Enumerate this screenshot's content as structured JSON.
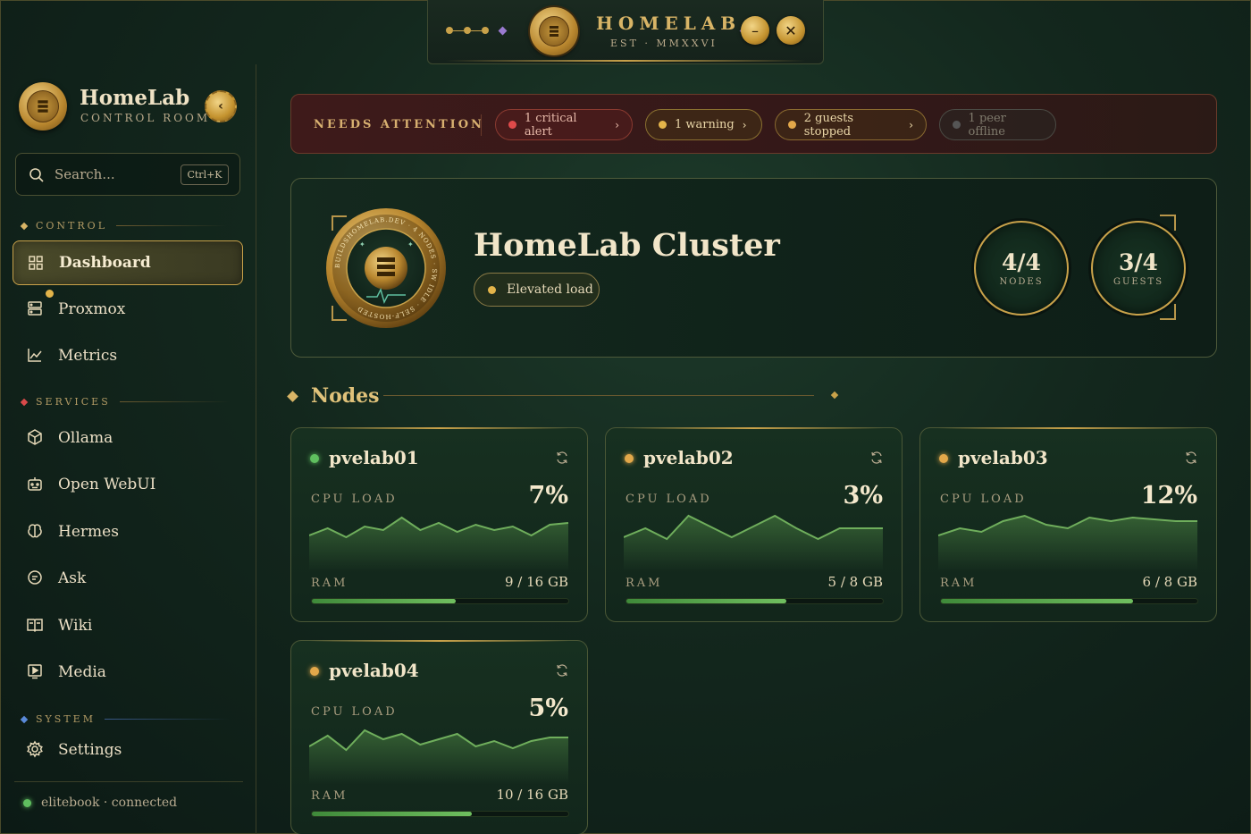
{
  "titlebar": {
    "title": "HOMELAB",
    "subtitle": "EST · MMXXVI",
    "minimize_glyph": "–",
    "close_glyph": "✕"
  },
  "sidebar": {
    "brand_name": "HomeLab",
    "brand_sub": "CONTROL ROOM",
    "collapse_glyph": "‹",
    "search": {
      "placeholder": "Search...",
      "shortcut": "Ctrl+K"
    },
    "sections": [
      {
        "title": "CONTROL",
        "color": "#d8b466"
      },
      {
        "title": "SERVICES",
        "color": "#d94a4a"
      },
      {
        "title": "SYSTEM",
        "color": "#5a8ad9"
      }
    ],
    "items": [
      {
        "label": "Dashboard",
        "icon": "grid-icon",
        "active": true
      },
      {
        "label": "Proxmox",
        "icon": "server-icon"
      },
      {
        "label": "Metrics",
        "icon": "chart-icon"
      },
      {
        "label": "Ollama",
        "icon": "cube-icon"
      },
      {
        "label": "Open WebUI",
        "icon": "robot-icon"
      },
      {
        "label": "Hermes",
        "icon": "brain-icon"
      },
      {
        "label": "Ask",
        "icon": "chat-icon"
      },
      {
        "label": "Wiki",
        "icon": "book-icon"
      },
      {
        "label": "Media",
        "icon": "play-icon"
      },
      {
        "label": "Settings",
        "icon": "gear-icon"
      }
    ],
    "connection": "elitebook · connected"
  },
  "attention": {
    "label": "NEEDS ATTENTION",
    "chips": [
      {
        "label": "1 critical alert",
        "color": "#e04a4a",
        "arrow": "›"
      },
      {
        "label": "1 warning",
        "color": "#e3b44a",
        "arrow": "›"
      },
      {
        "label": "2 guests stopped",
        "color": "#e3a84a",
        "arrow": "›"
      },
      {
        "label": "1 peer offline",
        "color": "#555555",
        "arrow": ""
      }
    ]
  },
  "hero": {
    "title": "HomeLab Cluster",
    "status": "Elevated load",
    "ring_text": "BUILDSHOMELAB.DEV · 4 NODES · SW IDLE · SELF-HOSTED",
    "stats": [
      {
        "value": "4/4",
        "label": "NODES"
      },
      {
        "value": "3/4",
        "label": "GUESTS"
      }
    ]
  },
  "nodes_section": {
    "title": "Nodes"
  },
  "nodes": [
    {
      "name": "pvelab01",
      "status_color": "#5fbf5f",
      "cpu_label": "CPU LOAD",
      "cpu": "7%",
      "ram_label": "RAM",
      "ram": "9 / 16 GB",
      "ram_fraction": 0.5625,
      "spark": [
        0.35,
        0.55,
        0.3,
        0.6,
        0.5,
        0.85,
        0.5,
        0.7,
        0.45,
        0.65,
        0.5,
        0.6,
        0.35,
        0.65,
        0.7
      ]
    },
    {
      "name": "pvelab02",
      "status_color": "#e3a84a",
      "cpu_label": "CPU LOAD",
      "cpu": "3%",
      "ram_label": "RAM",
      "ram": "5 / 8 GB",
      "ram_fraction": 0.625,
      "spark": [
        0.3,
        0.55,
        0.25,
        0.9,
        0.6,
        0.3,
        0.6,
        0.9,
        0.55,
        0.25,
        0.55,
        0.55,
        0.55
      ]
    },
    {
      "name": "pvelab03",
      "status_color": "#e3a84a",
      "cpu_label": "CPU LOAD",
      "cpu": "12%",
      "ram_label": "RAM",
      "ram": "6 / 8 GB",
      "ram_fraction": 0.75,
      "spark": [
        0.35,
        0.55,
        0.45,
        0.75,
        0.9,
        0.65,
        0.55,
        0.85,
        0.75,
        0.85,
        0.8,
        0.75,
        0.75
      ]
    },
    {
      "name": "pvelab04",
      "status_color": "#e3a84a",
      "cpu_label": "CPU LOAD",
      "cpu": "5%",
      "ram_label": "RAM",
      "ram": "10 / 16 GB",
      "ram_fraction": 0.625,
      "spark": [
        0.4,
        0.7,
        0.3,
        0.85,
        0.6,
        0.75,
        0.45,
        0.6,
        0.75,
        0.4,
        0.55,
        0.35,
        0.55,
        0.65,
        0.65
      ]
    }
  ]
}
